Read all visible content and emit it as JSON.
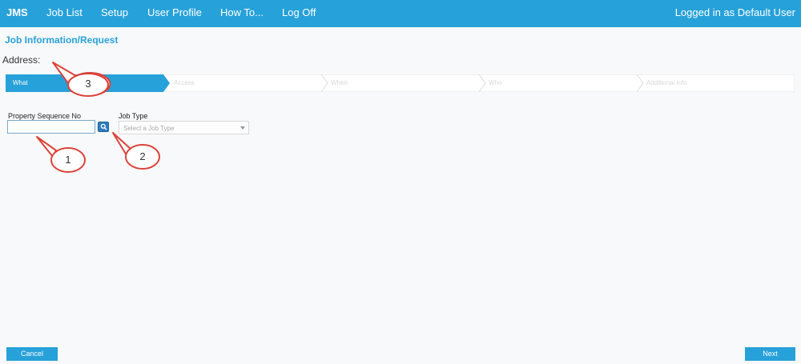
{
  "nav": {
    "brand": "JMS",
    "links": [
      "Job List",
      "Setup",
      "User Profile",
      "How To...",
      "Log Off"
    ],
    "user_status": "Logged in as Default User"
  },
  "page": {
    "title": "Job Information/Request",
    "address_label": "Address:"
  },
  "wizard": {
    "steps": [
      "What",
      "Access",
      "When",
      "Who",
      "Additional Info"
    ],
    "active_step": "What"
  },
  "form": {
    "property_seq_label": "Property Sequence No",
    "property_seq_value": "",
    "job_type_label": "Job Type",
    "job_type_placeholder": "Select a Job Type"
  },
  "annotations": [
    "1",
    "2",
    "3"
  ],
  "footer": {
    "cancel_label": "Cancel",
    "next_label": "Next"
  },
  "colors": {
    "accent": "#27a1d9",
    "annotation_red": "#d9433a"
  }
}
